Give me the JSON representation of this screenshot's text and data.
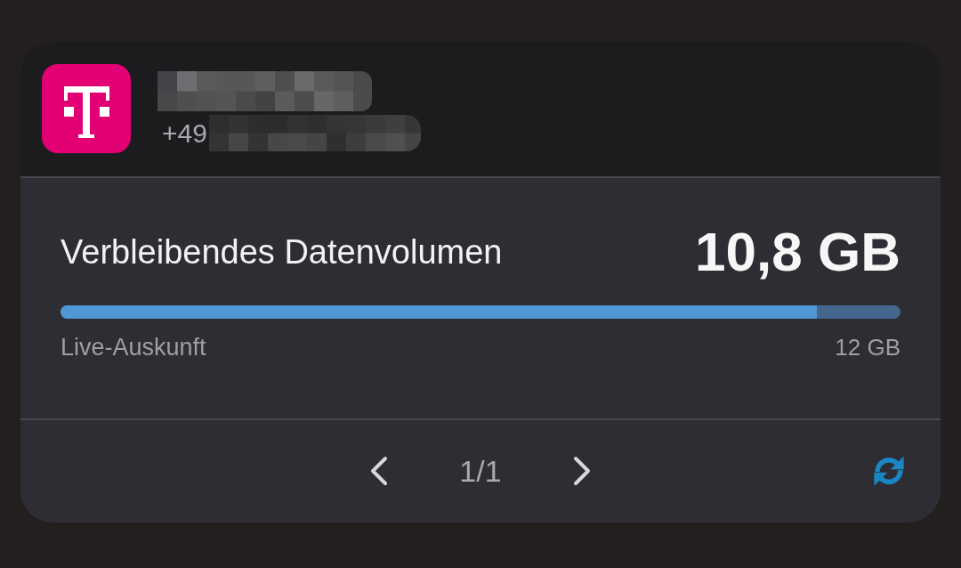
{
  "header": {
    "phone_prefix": "+49"
  },
  "data_volume": {
    "label": "Verbleibendes Datenvolumen",
    "remaining": "10,8 GB",
    "level": 0.9,
    "source": "Live-Auskunft",
    "total": "12 GB"
  },
  "pagination": {
    "page": "1/1"
  }
}
